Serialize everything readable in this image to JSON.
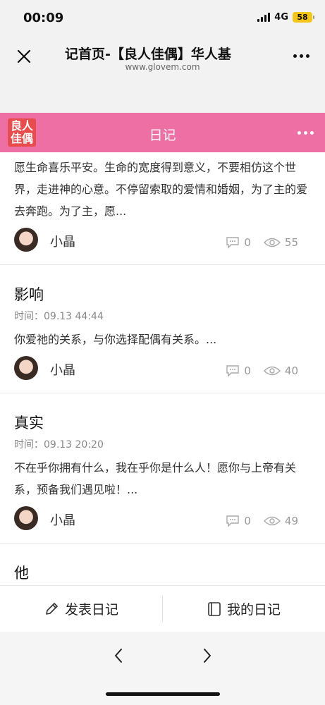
{
  "status_bar": {
    "time": "00:09",
    "network": "4G",
    "battery": "58"
  },
  "nav": {
    "title": "记首页-【良人佳偶】华人基",
    "url": "www.glovem.com"
  },
  "header": {
    "logo_text_1": "良人",
    "logo_text_2": "佳偶",
    "title": "日记"
  },
  "posts": [
    {
      "title": "",
      "time": "",
      "excerpt": "愿生命喜乐平安。生命的宽度得到意义，不要相仿这个世界，走进神的心意。不停留索取的爱情和婚姻，为了主的爱去奔跑。为了主，愿...",
      "author": "小晶",
      "comments": "0",
      "views": "55"
    },
    {
      "title": "影响",
      "time": "时间：09.13 44:44",
      "excerpt": "你爱祂的关系，与你选择配偶有关系。...",
      "author": "小晶",
      "comments": "0",
      "views": "40"
    },
    {
      "title": "真实",
      "time": "时间：09.13 20:20",
      "excerpt": "不在乎你拥有什么，我在乎你是什么人！愿你与上帝有关系，预备我们遇见啦！...",
      "author": "小晶",
      "comments": "0",
      "views": "49"
    },
    {
      "title": "他",
      "time": "",
      "excerpt": "",
      "author": "",
      "comments": "",
      "views": ""
    }
  ],
  "toolbar": {
    "publish_label": "发表日记",
    "my_diary_label": "我的日记"
  },
  "colors": {
    "header_pink": "#ee6fa3",
    "logo_red": "#e94c4c",
    "battery_yellow": "#f5c518"
  }
}
